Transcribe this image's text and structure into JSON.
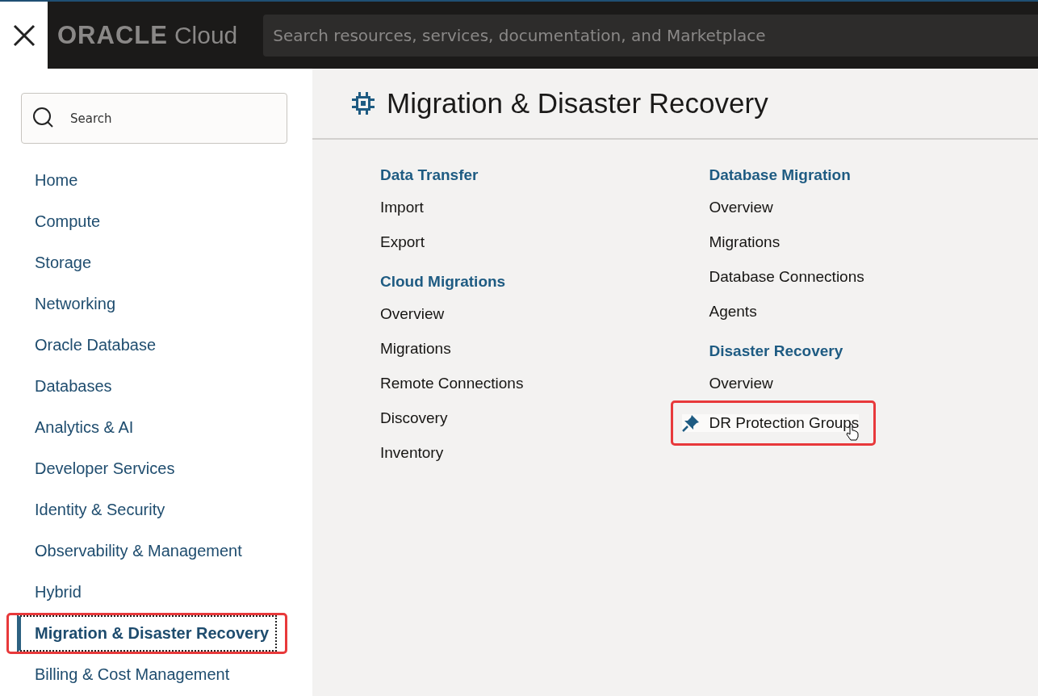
{
  "header": {
    "logo": {
      "brand": "ORACLE",
      "product": "Cloud"
    },
    "search": {
      "placeholder": "Search resources, services, documentation, and Marketplace"
    }
  },
  "sidebar": {
    "search": {
      "placeholder": "Search"
    },
    "items": [
      {
        "label": "Home",
        "selected": false,
        "highlighted": false
      },
      {
        "label": "Compute",
        "selected": false,
        "highlighted": false
      },
      {
        "label": "Storage",
        "selected": false,
        "highlighted": false
      },
      {
        "label": "Networking",
        "selected": false,
        "highlighted": false
      },
      {
        "label": "Oracle Database",
        "selected": false,
        "highlighted": false
      },
      {
        "label": "Databases",
        "selected": false,
        "highlighted": false
      },
      {
        "label": "Analytics & AI",
        "selected": false,
        "highlighted": false
      },
      {
        "label": "Developer Services",
        "selected": false,
        "highlighted": false
      },
      {
        "label": "Identity & Security",
        "selected": false,
        "highlighted": false
      },
      {
        "label": "Observability & Management",
        "selected": false,
        "highlighted": false
      },
      {
        "label": "Hybrid",
        "selected": false,
        "highlighted": false
      },
      {
        "label": "Migration & Disaster Recovery",
        "selected": true,
        "highlighted": true
      },
      {
        "label": "Billing & Cost Management",
        "selected": false,
        "highlighted": false
      }
    ]
  },
  "page": {
    "title": "Migration & Disaster Recovery",
    "columns": [
      [
        {
          "heading": "Data Transfer",
          "links": [
            {
              "label": "Import",
              "hovered": false,
              "highlighted": false
            },
            {
              "label": "Export",
              "hovered": false,
              "highlighted": false
            }
          ]
        },
        {
          "heading": "Cloud Migrations",
          "links": [
            {
              "label": "Overview",
              "hovered": false,
              "highlighted": false
            },
            {
              "label": "Migrations",
              "hovered": false,
              "highlighted": false
            },
            {
              "label": "Remote Connections",
              "hovered": false,
              "highlighted": false
            },
            {
              "label": "Discovery",
              "hovered": false,
              "highlighted": false
            },
            {
              "label": "Inventory",
              "hovered": false,
              "highlighted": false
            }
          ]
        }
      ],
      [
        {
          "heading": "Database Migration",
          "links": [
            {
              "label": "Overview",
              "hovered": false,
              "highlighted": false
            },
            {
              "label": "Migrations",
              "hovered": false,
              "highlighted": false
            },
            {
              "label": "Database Connections",
              "hovered": false,
              "highlighted": false
            },
            {
              "label": "Agents",
              "hovered": false,
              "highlighted": false
            }
          ]
        },
        {
          "heading": "Disaster Recovery",
          "links": [
            {
              "label": "Overview",
              "hovered": false,
              "highlighted": false
            },
            {
              "label": "DR Protection Groups",
              "hovered": true,
              "highlighted": true
            }
          ]
        }
      ]
    ]
  }
}
